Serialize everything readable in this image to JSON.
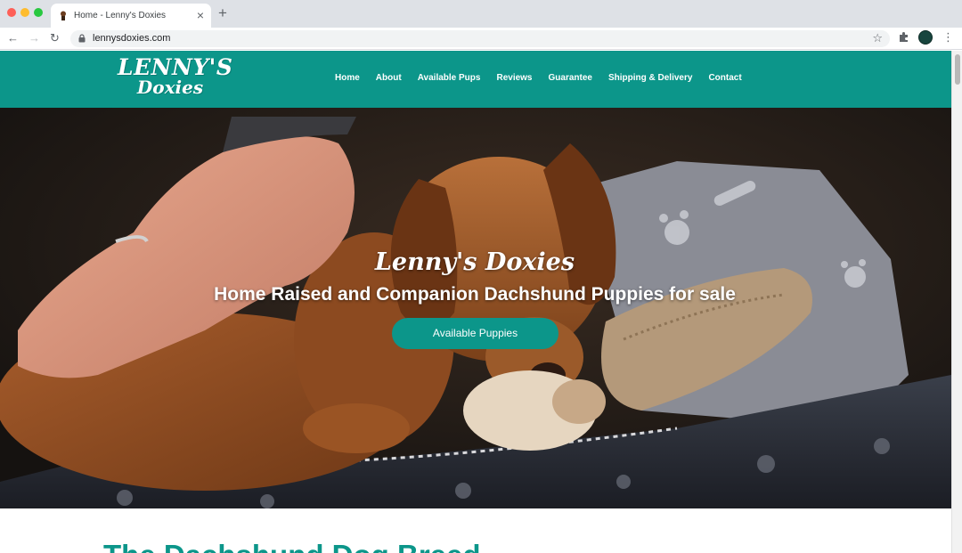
{
  "browser": {
    "tab_title": "Home - Lenny's Doxies",
    "tab_close_glyph": "×",
    "new_tab_glyph": "+",
    "url": "lennysdoxies.com",
    "back_glyph": "←",
    "forward_glyph": "→",
    "reload_glyph": "↻",
    "bookmark_glyph": "☆",
    "menu_glyph": "⋮",
    "icons": [
      "favicon-icon",
      "lock-icon",
      "extensions-icon",
      "profile-avatar"
    ]
  },
  "site": {
    "logo": {
      "line1": "LENNY'S",
      "line2": "Doxies"
    },
    "nav": [
      "Home",
      "About",
      "Available Pups",
      "Reviews",
      "Guarantee",
      "Shipping & Delivery",
      "Contact"
    ],
    "hero": {
      "title": "Lenny's Doxies",
      "subtitle": "Home Raised and Companion Dachshund Puppies for sale",
      "cta": "Available Puppies"
    },
    "section_title": "The Dachshund Dog Breed"
  },
  "colors": {
    "brand": "#0c968a",
    "white": "#ffffff",
    "chrome": "#dee1e6"
  }
}
